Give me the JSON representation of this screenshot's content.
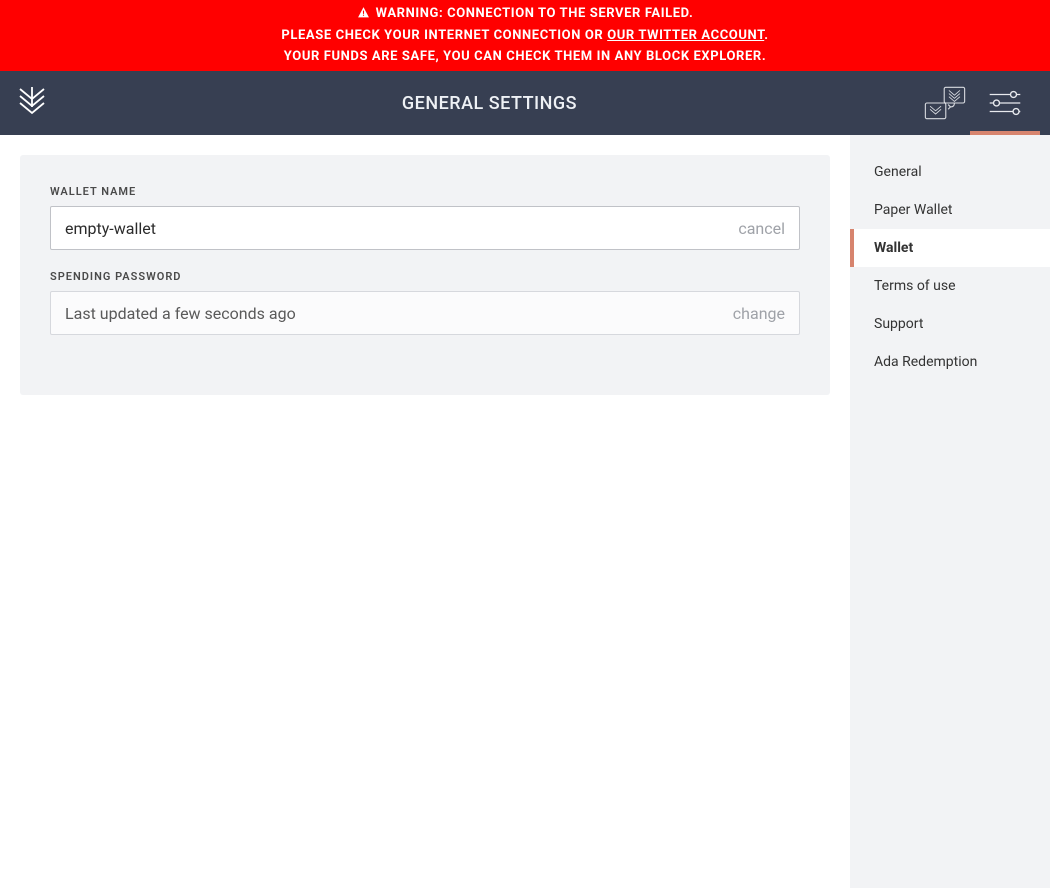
{
  "warning": {
    "line1": "WARNING: CONNECTION TO THE SERVER FAILED.",
    "line2_prefix": "PLEASE CHECK YOUR INTERNET CONNECTION OR ",
    "line2_link": "OUR TWITTER ACCOUNT",
    "line2_suffix": ".",
    "line3": "YOUR FUNDS ARE SAFE, YOU CAN CHECK THEM IN ANY BLOCK EXPLORER."
  },
  "topbar": {
    "title": "GENERAL SETTINGS"
  },
  "fields": {
    "wallet_name": {
      "label": "WALLET NAME",
      "value": "empty-wallet",
      "action": "cancel"
    },
    "spending_password": {
      "label": "SPENDING PASSWORD",
      "status": "Last updated a few seconds ago",
      "action": "change"
    }
  },
  "sidebar": {
    "items": [
      {
        "label": "General",
        "active": false
      },
      {
        "label": "Paper Wallet",
        "active": false
      },
      {
        "label": "Wallet",
        "active": true
      },
      {
        "label": "Terms of use",
        "active": false
      },
      {
        "label": "Support",
        "active": false
      },
      {
        "label": "Ada Redemption",
        "active": false
      }
    ]
  }
}
